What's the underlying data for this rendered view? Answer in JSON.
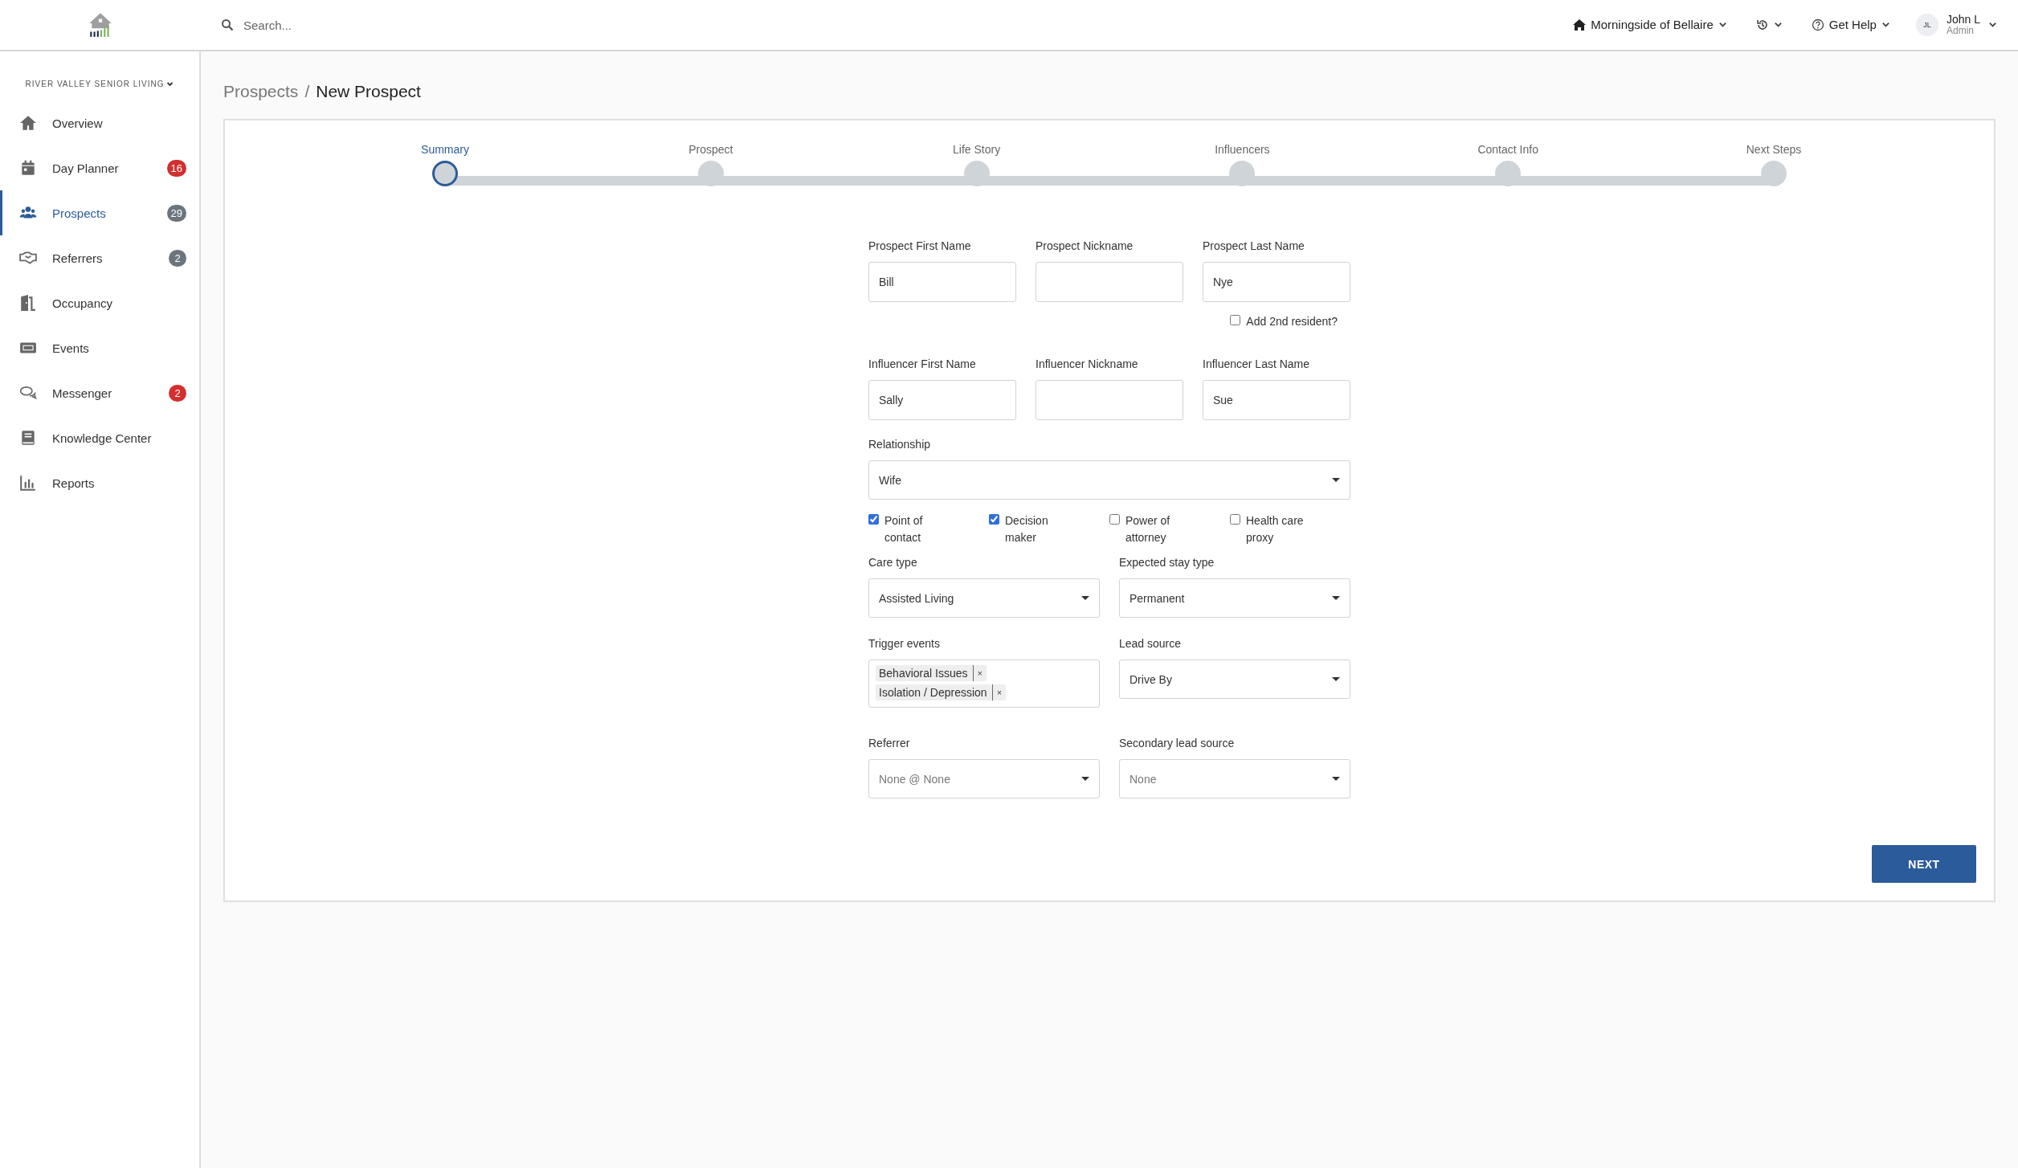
{
  "header": {
    "search": {
      "placeholder": "Search..."
    },
    "community": "Morningside of Bellaire",
    "help": "Get Help",
    "user": {
      "initials": "JL",
      "name": "John L",
      "role": "Admin"
    }
  },
  "sidebar": {
    "organization": "RIVER VALLEY SENIOR LIVING",
    "items": [
      {
        "label": "Overview",
        "selected": false
      },
      {
        "label": "Day Planner",
        "selected": false,
        "badge": "16",
        "color": "#d32f2f"
      },
      {
        "label": "Prospects",
        "selected": true,
        "badge": "29",
        "color": "#6c757d"
      },
      {
        "label": "Referrers",
        "selected": false,
        "badge": "2",
        "color": "#6c757d"
      },
      {
        "label": "Occupancy",
        "selected": false
      },
      {
        "label": "Events",
        "selected": false
      },
      {
        "label": "Messenger",
        "selected": false,
        "badge": "2",
        "color": "#d32f2f"
      },
      {
        "label": "Knowledge Center",
        "selected": false
      },
      {
        "label": "Reports",
        "selected": false
      }
    ]
  },
  "breadcrumb": {
    "parent": "Prospects",
    "separator": "/",
    "current": "New Prospect"
  },
  "steps": [
    {
      "label": "Summary",
      "selected": true
    },
    {
      "label": "Prospect",
      "selected": false
    },
    {
      "label": "Life Story",
      "selected": false
    },
    {
      "label": "Influencers",
      "selected": false
    },
    {
      "label": "Contact Info",
      "selected": false
    },
    {
      "label": "Next Steps",
      "selected": false
    }
  ],
  "prospect_fields": [
    {
      "label": "Prospect First Name",
      "value": "Bill"
    },
    {
      "label": "Prospect Nickname"
    },
    {
      "label": "Prospect Last Name",
      "value": "Nye"
    }
  ],
  "add_second_resident": {
    "label": "Add 2nd resident?",
    "checked": false
  },
  "influencer_fields": [
    {
      "label": "Influencer First Name",
      "value": "Sally"
    },
    {
      "label": "Influencer Nickname"
    },
    {
      "label": "Influencer Last Name",
      "value": "Sue"
    }
  ],
  "relationship": {
    "label": "Relationship",
    "value": "Wife"
  },
  "roles": [
    {
      "label": "Point of contact",
      "checked": true
    },
    {
      "label": "Decision maker",
      "checked": true
    },
    {
      "label": "Power of attorney",
      "checked": false
    },
    {
      "label": "Health care proxy",
      "checked": false
    }
  ],
  "details": [
    {
      "kind": "select",
      "label": "Care type",
      "value": "Assisted Living"
    },
    {
      "kind": "select",
      "label": "Expected stay type",
      "value": "Permanent"
    },
    {
      "kind": "tags",
      "label": "Trigger events",
      "tags": [
        {
          "text": "Behavioral Issues",
          "remove": "×"
        },
        {
          "text": "Isolation / Depression",
          "remove": "×"
        }
      ]
    },
    {
      "kind": "select",
      "label": "Lead source",
      "value": "Drive By"
    },
    {
      "kind": "select",
      "label": "Referrer",
      "placeholder": "None @ None"
    },
    {
      "kind": "select",
      "label": "Secondary lead source",
      "placeholder": "None"
    }
  ],
  "next_button": "NEXT"
}
